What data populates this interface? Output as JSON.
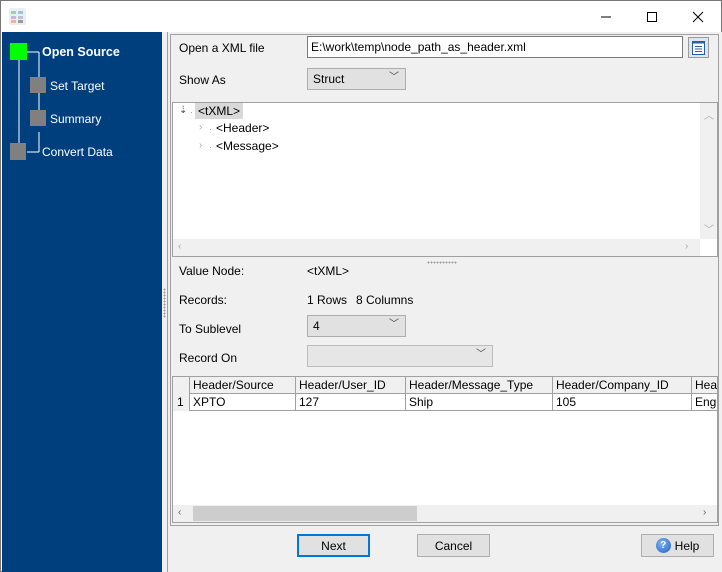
{
  "window": {
    "title": "",
    "controls": {
      "minimize": "—",
      "maximize": "☐",
      "close": "✕"
    }
  },
  "colors": {
    "sidebar_bg": "#003f7e",
    "step_active": "#00ff00",
    "step_inactive": "#808080",
    "default_button_border": "#0078d7"
  },
  "steps": [
    {
      "label": "Open Source",
      "active": true,
      "level": 0
    },
    {
      "label": "Set Target",
      "active": false,
      "level": 1
    },
    {
      "label": "Summary",
      "active": false,
      "level": 1
    },
    {
      "label": "Convert Data",
      "active": false,
      "level": 0
    }
  ],
  "form": {
    "open_file_label": "Open a XML file",
    "file_path": "E:\\work\\temp\\node_path_as_header.xml",
    "browse_icon": "document-icon",
    "show_as_label": "Show As",
    "show_as_value": "Struct"
  },
  "tree": {
    "nodes": [
      {
        "label": "<tXML>",
        "expanded": true,
        "selected": true,
        "level": 0
      },
      {
        "label": "<Header>",
        "expanded": false,
        "selected": false,
        "level": 1
      },
      {
        "label": "<Message>",
        "expanded": false,
        "selected": false,
        "level": 1
      }
    ]
  },
  "info": {
    "value_node_label": "Value Node:",
    "value_node": "<tXML>",
    "records_label": "Records:",
    "rows": "1 Rows",
    "columns": "8 Columns",
    "sublevel_label": "To Sublevel",
    "sublevel_value": "4",
    "record_on_label": "Record On",
    "record_on_value": ""
  },
  "grid": {
    "headers": [
      "Header/Source",
      "Header/User_ID",
      "Header/Message_Type",
      "Header/Company_ID",
      "Hea"
    ],
    "rows": [
      {
        "num": "1",
        "cells": [
          "XPTO",
          "127",
          "Ship",
          "105",
          "Eng"
        ]
      }
    ]
  },
  "buttons": {
    "next": "Next",
    "cancel": "Cancel",
    "help": "Help",
    "help_icon_glyph": "?"
  }
}
